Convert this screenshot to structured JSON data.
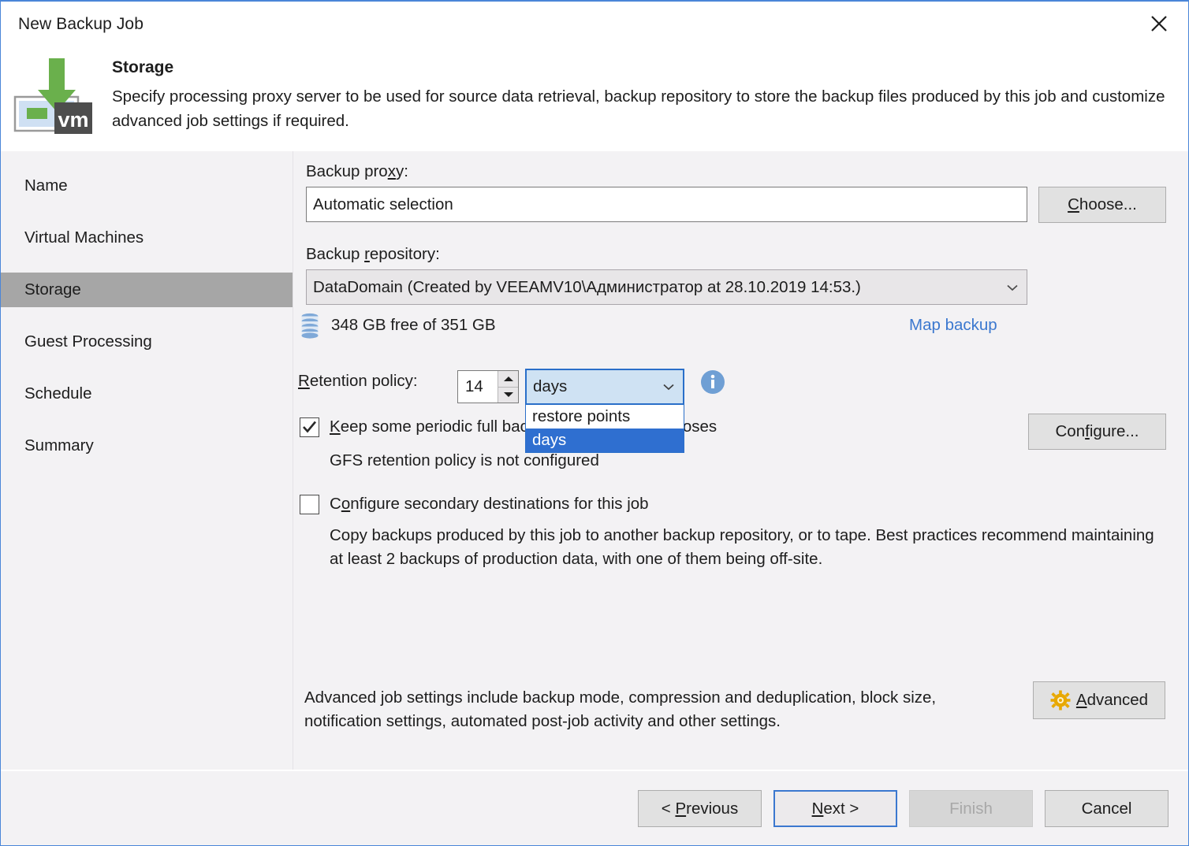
{
  "window": {
    "title": "New Backup Job",
    "close_icon": "close-icon"
  },
  "header": {
    "icon": "storage-vm-icon",
    "title": "Storage",
    "description": "Specify processing proxy server to be used for source data retrieval, backup repository to store the backup files produced by this job and customize advanced job settings if required."
  },
  "sidebar": {
    "items": [
      {
        "label": "Name",
        "active": false
      },
      {
        "label": "Virtual Machines",
        "active": false
      },
      {
        "label": "Storage",
        "active": true
      },
      {
        "label": "Guest Processing",
        "active": false
      },
      {
        "label": "Schedule",
        "active": false
      },
      {
        "label": "Summary",
        "active": false
      }
    ]
  },
  "main": {
    "backup_proxy": {
      "label_pre": "Backup pro",
      "label_accel": "x",
      "label_post": "y:",
      "label_full": "Backup proxy:",
      "value": "Automatic selection",
      "choose_button": "Choose..."
    },
    "backup_repository": {
      "label_full": "Backup repository:",
      "value": "DataDomain (Created by VEEAMV10\\Администратор at 28.10.2019 14:53.)",
      "free_space": "348 GB free of 351 GB",
      "storage_icon": "database-icon",
      "map_backup_link": "Map backup"
    },
    "retention": {
      "label_full": "Retention policy:",
      "value": "14",
      "unit_selected": "days",
      "unit_options": [
        "restore points",
        "days"
      ],
      "info_icon": "info-icon",
      "spinner_up_icon": "spinner-up-icon",
      "spinner_down_icon": "spinner-down-icon"
    },
    "gfs": {
      "checkbox_checked": true,
      "label": "Keep some periodic full backups for archival purposes",
      "status": "GFS retention policy is not configured",
      "configure_button": "Configure..."
    },
    "secondary": {
      "checkbox_checked": false,
      "label": "Configure secondary destinations for this job",
      "description": "Copy backups produced by this job to another backup repository, or to tape. Best practices recommend maintaining at least 2 backups of production data, with one of them being off-site."
    },
    "advanced": {
      "description": "Advanced job settings include backup mode, compression and deduplication, block size, notification settings, automated post-job activity and other settings.",
      "button_label": "Advanced",
      "button_icon": "gear-icon"
    }
  },
  "footer": {
    "previous": "< Previous",
    "next": "Next >",
    "finish": "Finish",
    "cancel": "Cancel"
  },
  "colors": {
    "accent": "#3b78cf",
    "link": "#3b78cf",
    "selection": "#2f6fd0",
    "body_bg": "#f3f2f4",
    "sidebar_active": "#a6a6a6",
    "icon_green": "#6ab04c",
    "icon_gold": "#e8a800"
  }
}
